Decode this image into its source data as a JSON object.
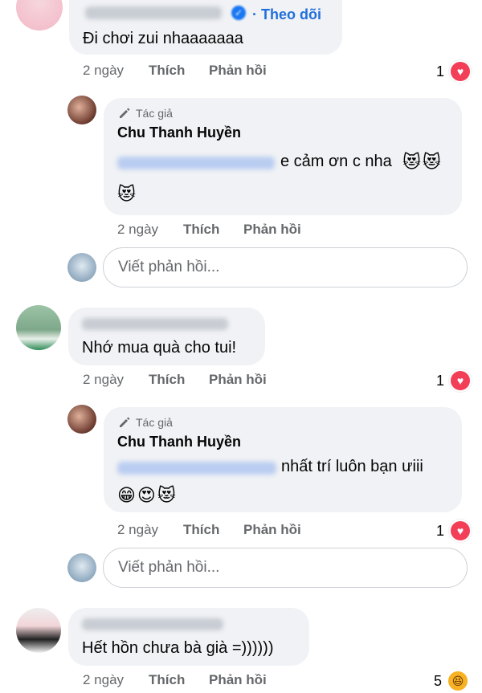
{
  "comments": [
    {
      "text": "Đi chơi zui nhaaaaaaa",
      "time": "2 ngày",
      "like": "Thích",
      "reply": "Phản hồi",
      "follow": "· Theo dõi",
      "reactions": "1",
      "reaction_type": "heart"
    },
    {
      "text": "Nhớ mua quà cho tui!",
      "time": "2 ngày",
      "like": "Thích",
      "reply": "Phản hồi",
      "reactions": "1",
      "reaction_type": "heart"
    },
    {
      "text": "Hết hồn chưa bà già =))))))",
      "time": "2 ngày",
      "like": "Thích",
      "reply": "Phản hồi",
      "reactions": "5",
      "reaction_type": "haha"
    }
  ],
  "replies": [
    {
      "badge": "Tác giả",
      "author": "Chu Thanh Huyền",
      "text": "e cảm ơn c nha",
      "emojis_inline": "😻😻",
      "emojis_line": "😻",
      "time": "2 ngày",
      "like": "Thích",
      "reply": "Phản hồi"
    },
    {
      "badge": "Tác giả",
      "author": "Chu Thanh Huyền",
      "text": "nhất trí luôn bạn ưiii",
      "emojis_line": "😁😍😻",
      "time": "2 ngày",
      "like": "Thích",
      "reply": "Phản hồi",
      "reactions": "1",
      "reaction_type": "heart"
    }
  ],
  "reply_input": {
    "placeholder": "Viết phản hồi..."
  },
  "icons": {
    "author_badge": "pen-icon",
    "heart": "heart-icon",
    "haha": "haha-icon"
  },
  "colors": {
    "bubble": "#f0f2f5",
    "link": "#216fdb",
    "heart": "#f33e58",
    "haha": "#f7b125",
    "muted": "#65676b"
  }
}
